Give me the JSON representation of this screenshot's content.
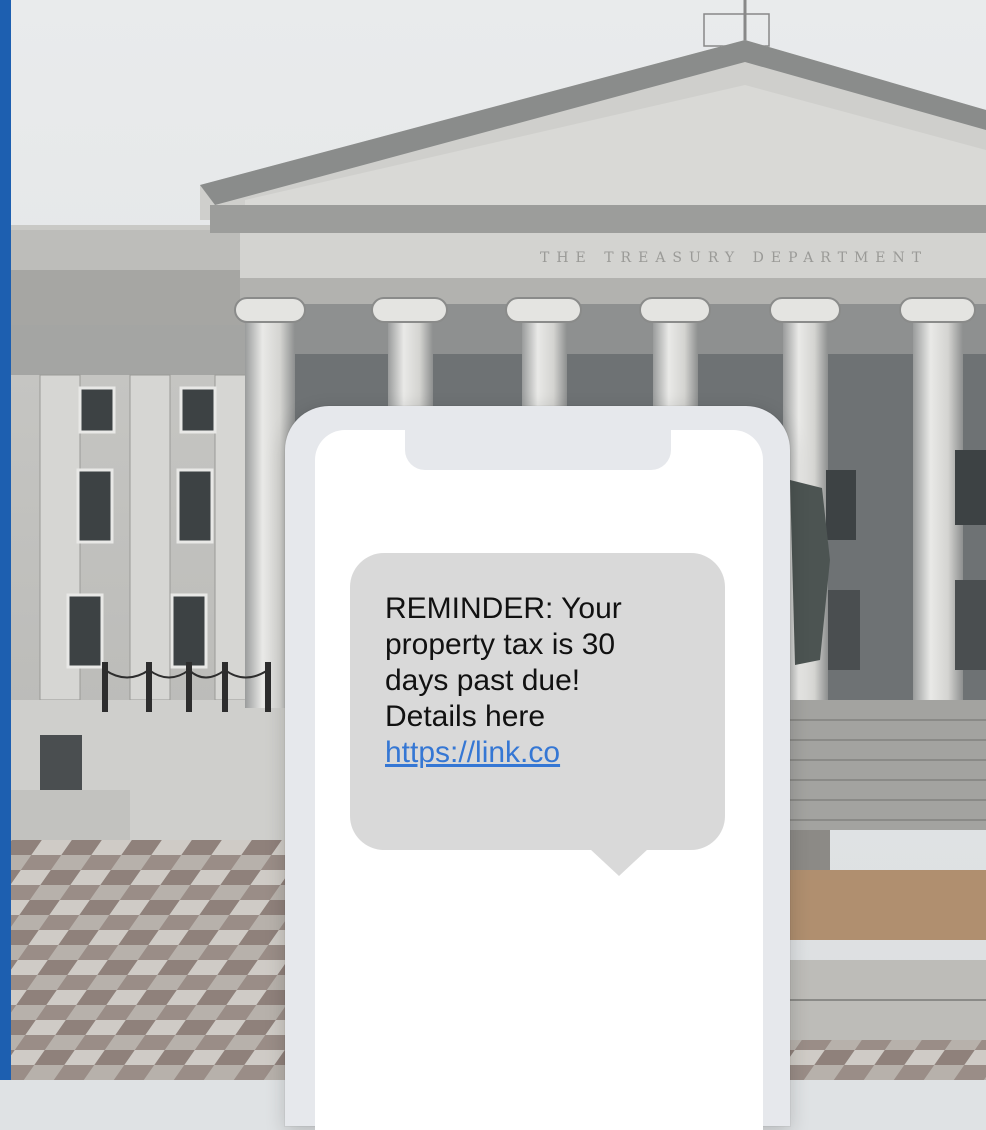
{
  "background": {
    "building_inscription": "THE TREASURY DEPARTMENT",
    "accent_color": "#1d5fb0"
  },
  "message": {
    "lines": [
      "REMINDER: Your",
      "property tax is 30",
      "days past due!",
      "Details here"
    ],
    "link_text": "https://link.co",
    "bubble_color": "#d9d9d9",
    "link_color": "#3577d4"
  }
}
